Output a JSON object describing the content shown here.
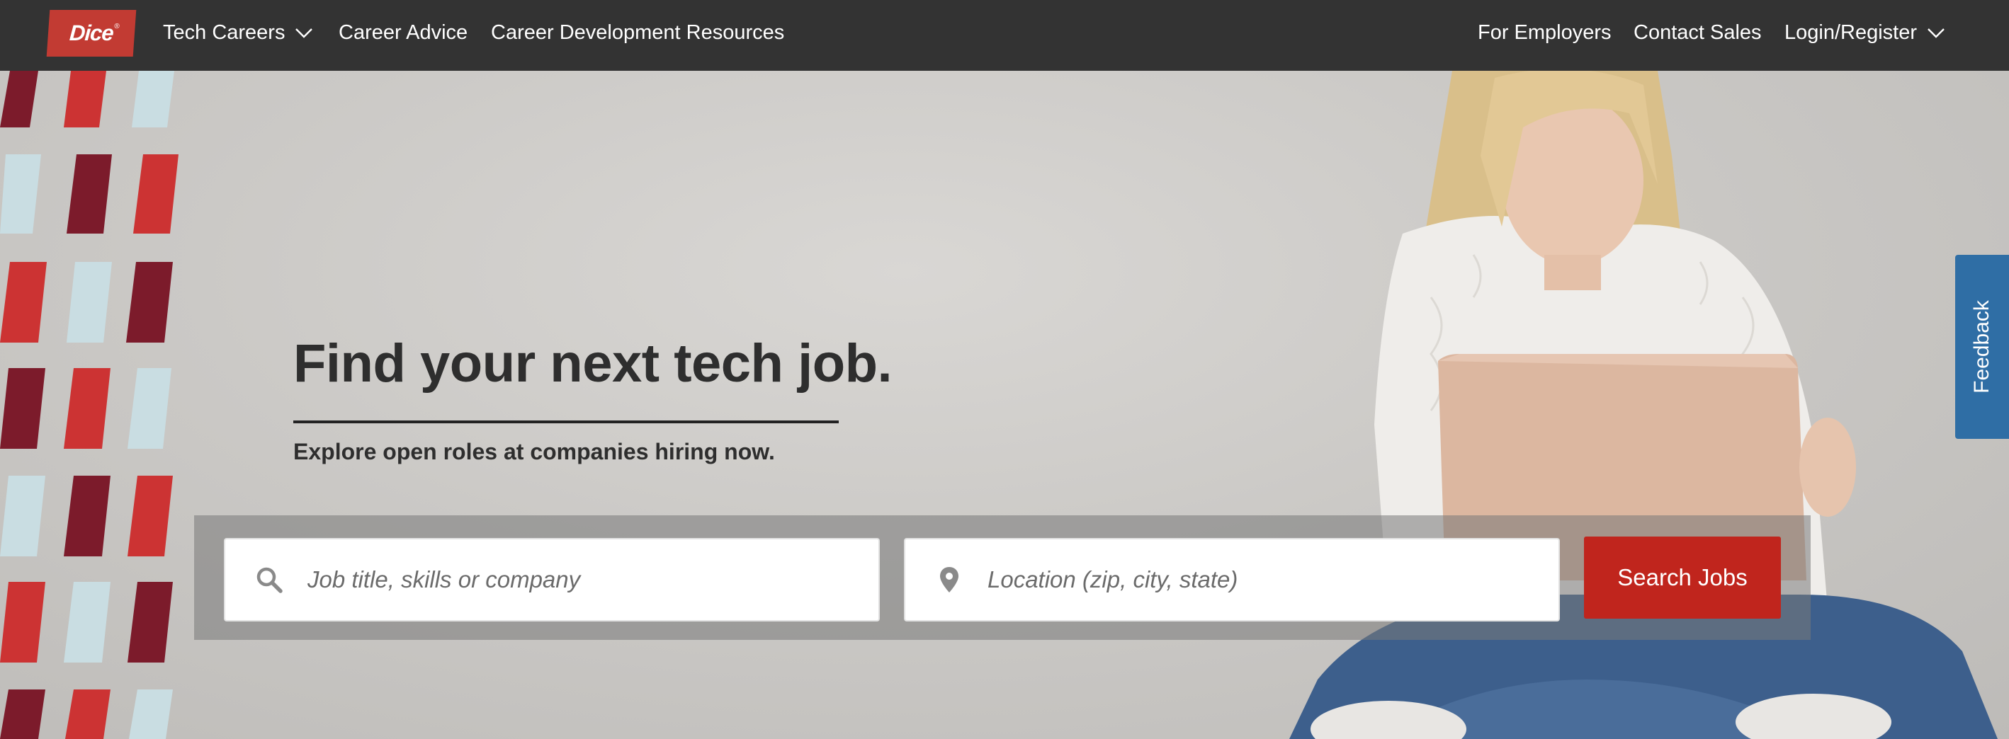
{
  "brand": {
    "logo_text": "Dice",
    "logo_mark": "®",
    "accent": "#c23b33"
  },
  "nav": {
    "left": [
      {
        "label": "Tech Careers",
        "has_dropdown": true
      },
      {
        "label": "Career Advice",
        "has_dropdown": false
      },
      {
        "label": "Career Development Resources",
        "has_dropdown": false
      }
    ],
    "right": [
      {
        "label": "For Employers",
        "has_dropdown": false
      },
      {
        "label": "Contact Sales",
        "has_dropdown": false
      },
      {
        "label": "Login/Register",
        "has_dropdown": true
      }
    ]
  },
  "hero": {
    "headline": "Find your next tech job.",
    "subheadline": "Explore open roles at companies hiring now."
  },
  "search": {
    "keyword_placeholder": "Job title, skills or company",
    "keyword_icon": "search-icon",
    "location_placeholder": "Location (zip, city, state)",
    "location_icon": "location-pin-icon",
    "button_label": "Search Jobs",
    "button_color": "#c0251d"
  },
  "feedback": {
    "label": "Feedback",
    "color": "#2f6ea5"
  }
}
